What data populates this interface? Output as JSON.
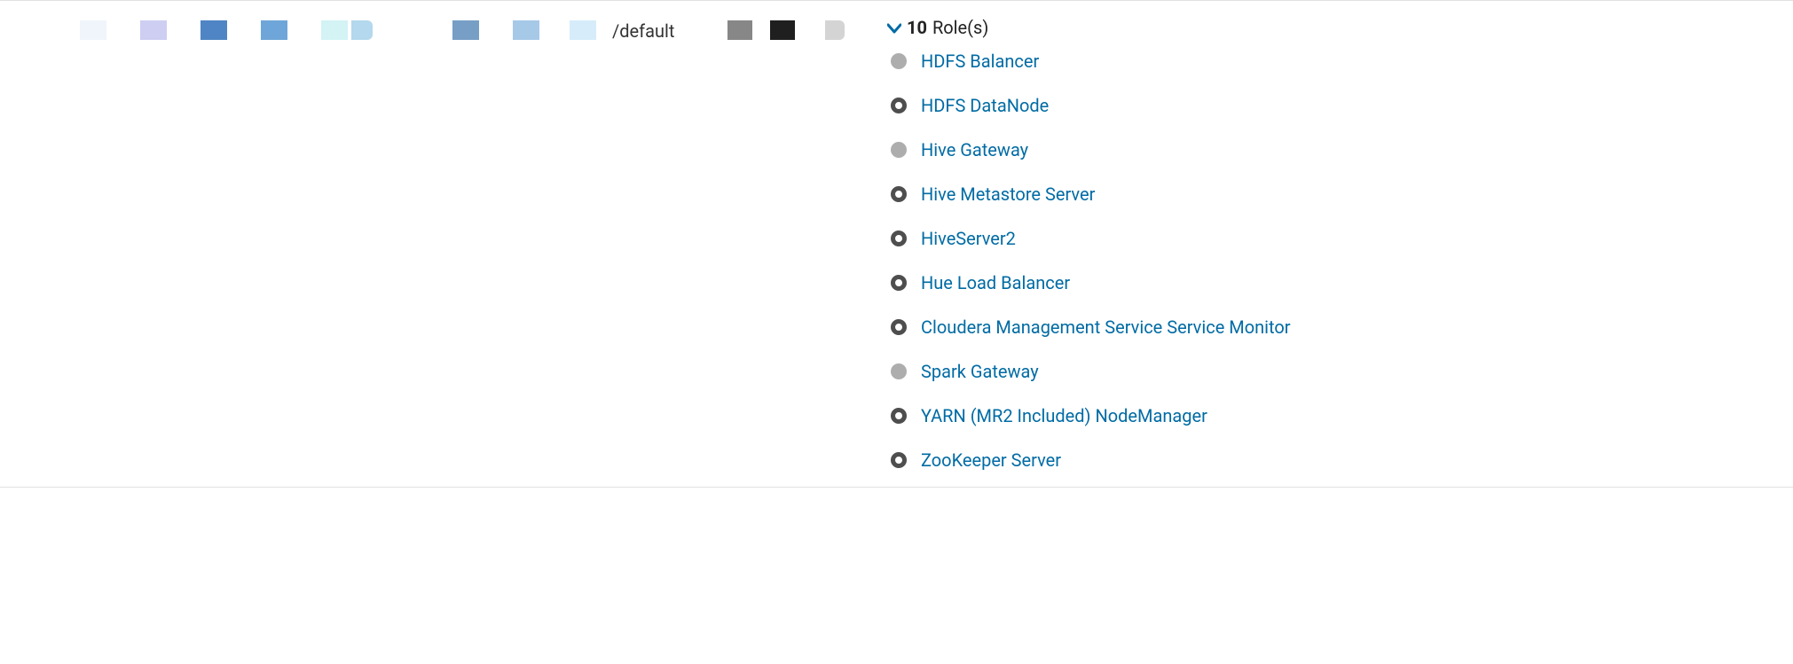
{
  "row": {
    "rack": "/default",
    "roles_header": {
      "count": "10",
      "label": "Role(s)"
    },
    "roles": [
      {
        "status": "solid",
        "name": "HDFS Balancer"
      },
      {
        "status": "ring",
        "name": "HDFS DataNode"
      },
      {
        "status": "solid",
        "name": "Hive Gateway"
      },
      {
        "status": "ring",
        "name": "Hive Metastore Server"
      },
      {
        "status": "ring",
        "name": "HiveServer2"
      },
      {
        "status": "ring",
        "name": "Hue Load Balancer"
      },
      {
        "status": "ring",
        "name": "Cloudera Management Service Service Monitor"
      },
      {
        "status": "solid",
        "name": "Spark Gateway"
      },
      {
        "status": "ring",
        "name": "YARN (MR2 Included) NodeManager"
      },
      {
        "status": "ring",
        "name": "ZooKeeper Server"
      }
    ]
  }
}
